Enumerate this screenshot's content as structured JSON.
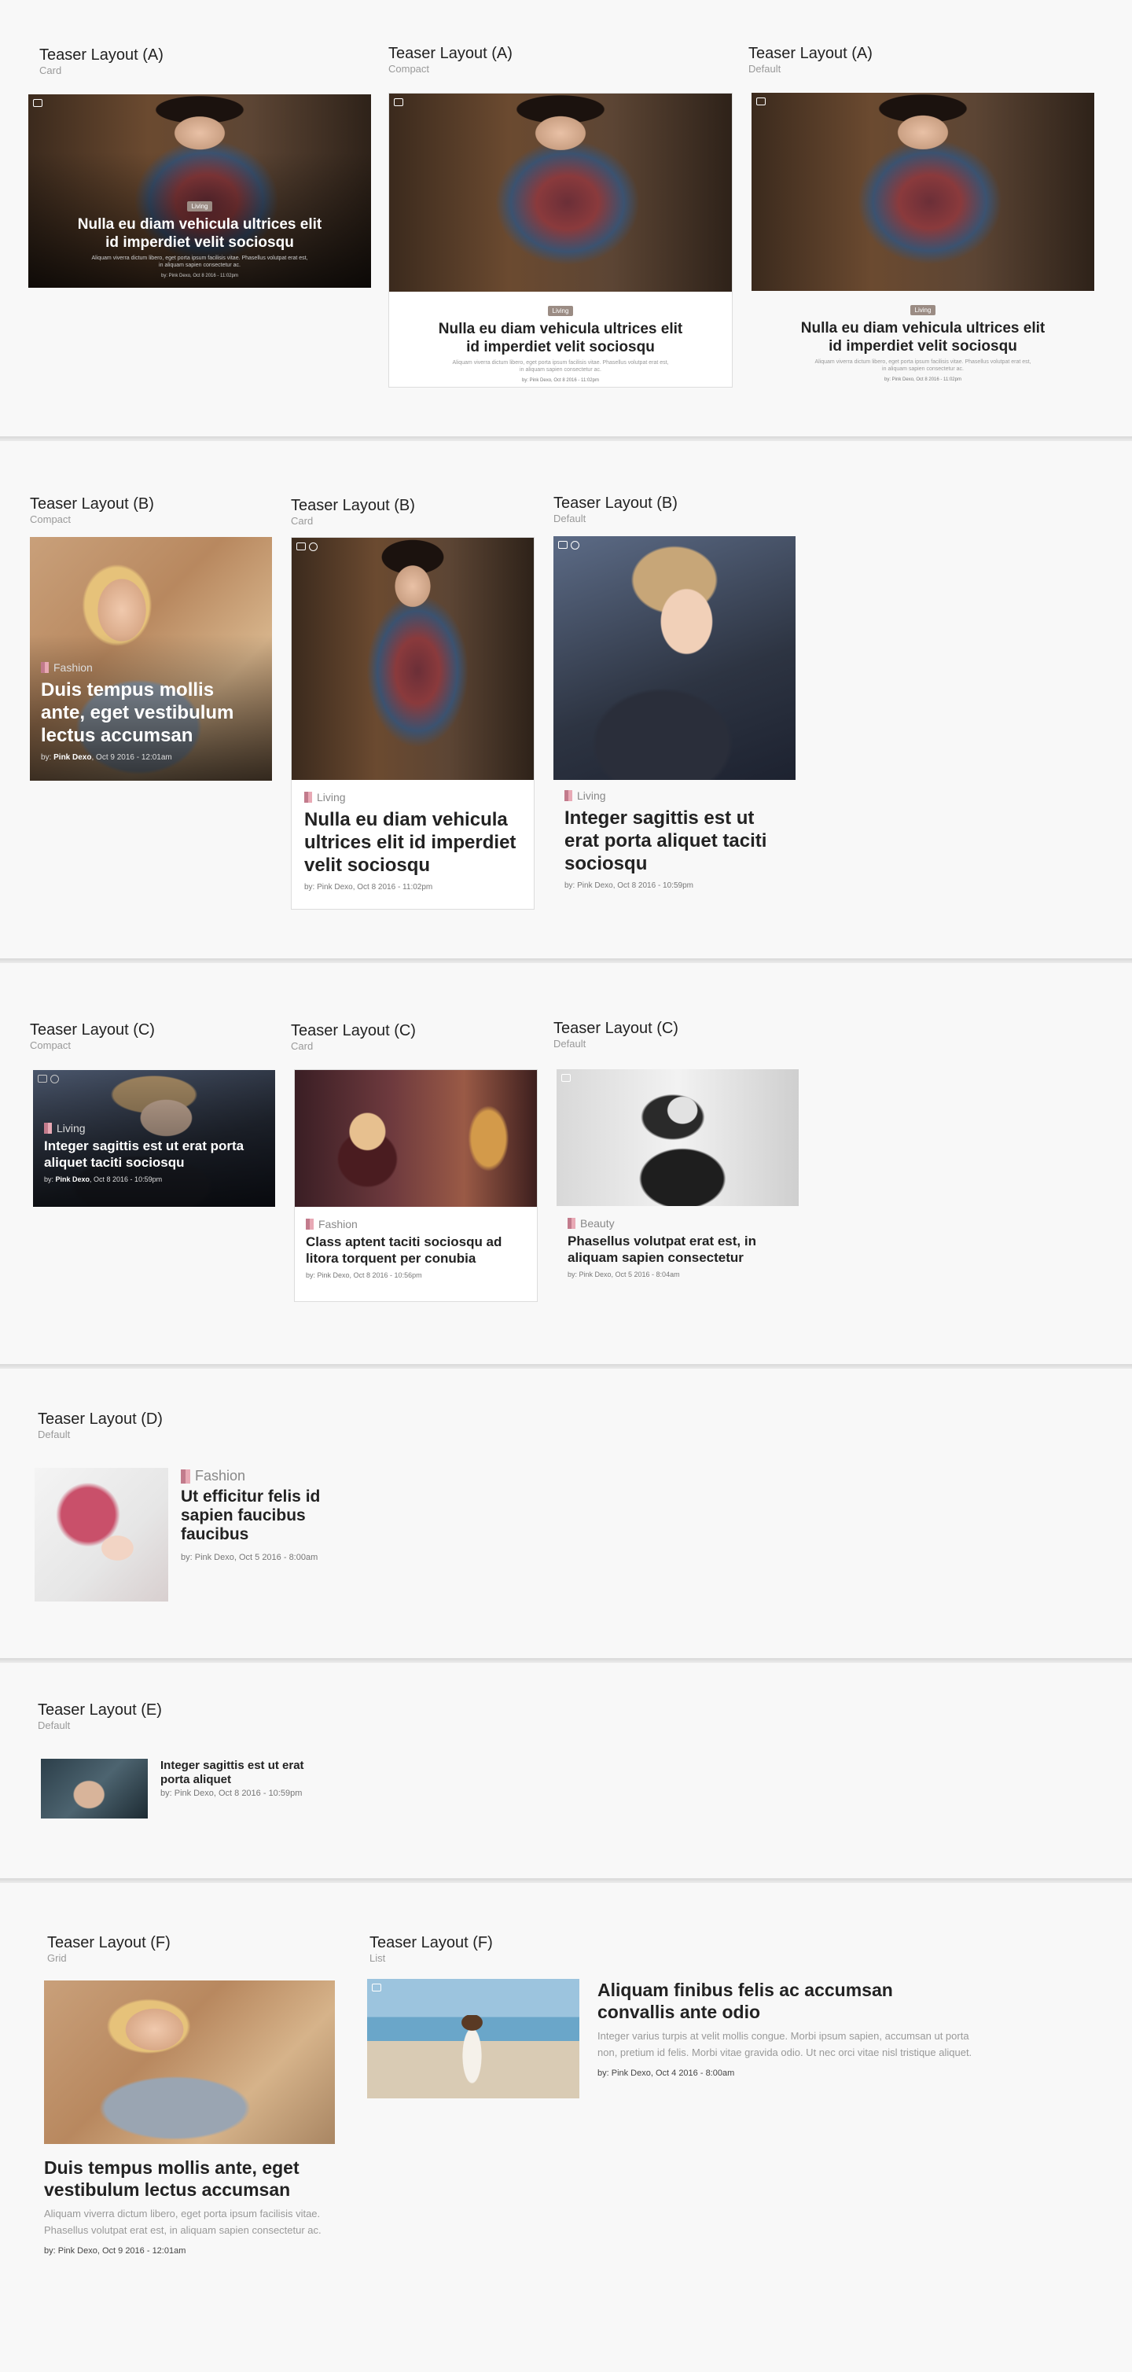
{
  "sec_a": {
    "cols": [
      {
        "title": "Teaser Layout (A)",
        "sub": "Card"
      },
      {
        "title": "Teaser Layout (A)",
        "sub": "Compact"
      },
      {
        "title": "Teaser Layout (A)",
        "sub": "Default"
      }
    ],
    "badge": "Living",
    "headline": "Nulla eu diam vehicula ultrices elit id imperdiet velit sociosqu",
    "excerpt": "Aliquam viverra dictum libero, eget porta ipsum facilisis vitae. Phasellus volutpat erat est, in aliquam sapien consectetur ac.",
    "meta": "by: Pink Dexo, Oct 8 2016 - 11:02pm"
  },
  "sec_b": {
    "cols": [
      {
        "title": "Teaser Layout (B)",
        "sub": "Compact",
        "category": "Fashion",
        "headline": "Duis tempus mollis ante, eget vestibulum lectus accumsan",
        "author": "Pink Dexo",
        "date": ", Oct 9 2016 - 12:01am"
      },
      {
        "title": "Teaser Layout (B)",
        "sub": "Card",
        "category": "Living",
        "headline": "Nulla eu diam vehicula ultrices elit id imperdiet velit sociosqu",
        "meta": "by: Pink Dexo, Oct 8 2016 - 11:02pm"
      },
      {
        "title": "Teaser Layout (B)",
        "sub": "Default",
        "category": "Living",
        "headline": "Integer sagittis est ut erat porta aliquet taciti sociosqu",
        "meta": "by: Pink Dexo, Oct 8 2016 - 10:59pm"
      }
    ]
  },
  "sec_c": {
    "cols": [
      {
        "title": "Teaser Layout (C)",
        "sub": "Compact",
        "category": "Living",
        "headline": "Integer sagittis est ut erat porta aliquet taciti sociosqu",
        "author": "Pink Dexo",
        "date": ", Oct 8 2016 - 10:59pm"
      },
      {
        "title": "Teaser Layout (C)",
        "sub": "Card",
        "category": "Fashion",
        "headline": "Class aptent taciti sociosqu ad litora torquent per conubia",
        "meta": "by: Pink Dexo, Oct 8 2016 - 10:56pm"
      },
      {
        "title": "Teaser Layout (C)",
        "sub": "Default",
        "category": "Beauty",
        "headline": "Phasellus volutpat erat est, in aliquam sapien consectetur",
        "meta": "by: Pink Dexo, Oct 5 2016 - 8:04am"
      }
    ]
  },
  "sec_d": {
    "title": "Teaser Layout (D)",
    "sub": "Default",
    "category": "Fashion",
    "headline": "Ut efficitur felis id sapien faucibus faucibus",
    "meta": "by: Pink Dexo, Oct 5 2016 - 8:00am"
  },
  "sec_e": {
    "title": "Teaser Layout (E)",
    "sub": "Default",
    "headline": "Integer sagittis est ut erat porta aliquet",
    "meta": "by: Pink Dexo, Oct 8 2016 - 10:59pm"
  },
  "sec_f": {
    "grid": {
      "title": "Teaser Layout (F)",
      "sub": "Grid",
      "headline": "Duis tempus mollis ante, eget vestibulum lectus accumsan",
      "excerpt": "Aliquam viverra dictum libero, eget porta ipsum facilisis vitae. Phasellus volutpat erat est, in aliquam sapien consectetur ac.",
      "meta": "by: Pink Dexo, Oct 9 2016 - 12:01am"
    },
    "list": {
      "title": "Teaser Layout (F)",
      "sub": "List",
      "headline": "Aliquam finibus felis ac accumsan convallis ante odio",
      "excerpt": "Integer varius turpis at velit mollis congue. Morbi ipsum sapien, accumsan ut porta non, pretium id felis. Morbi vitae gravida odio. Ut nec orci vitae nisl tristique aliquet.",
      "meta": "by: Pink Dexo, Oct 4 2016 - 8:00am"
    }
  }
}
